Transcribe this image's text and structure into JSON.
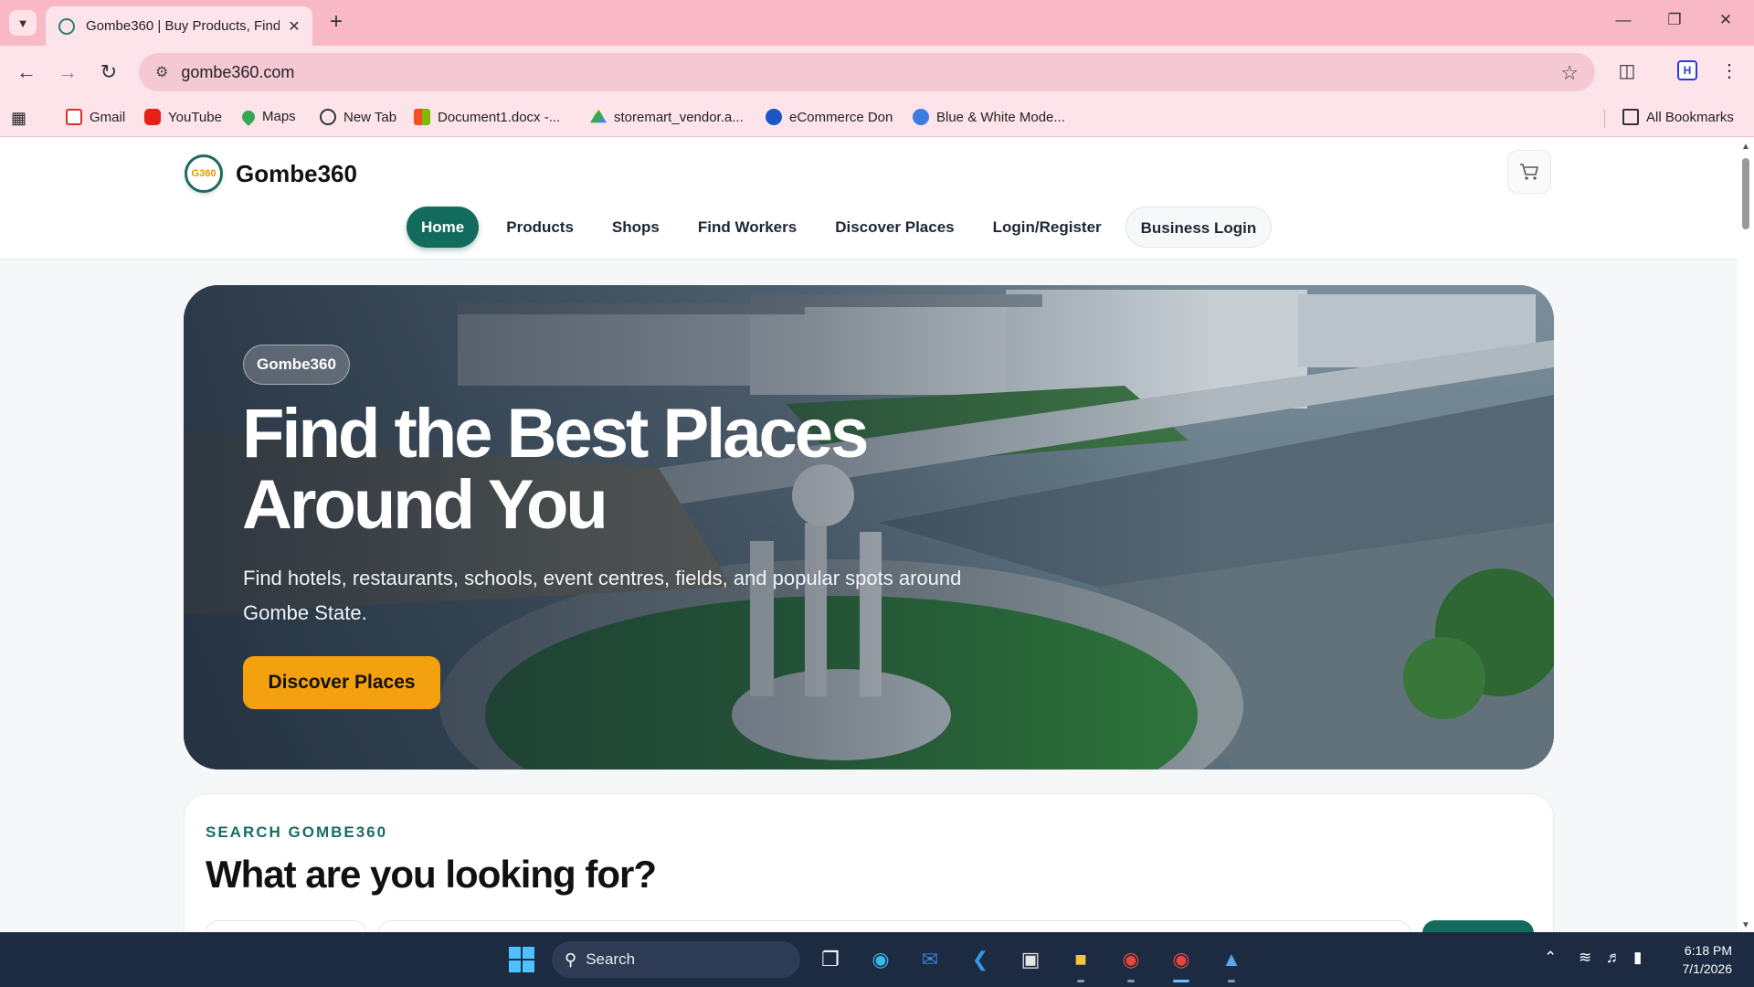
{
  "browser": {
    "tab_title": "Gombe360 | Buy Products, Find",
    "url": "gombe360.com",
    "bookmarks": [
      "Gmail",
      "YouTube",
      "Maps",
      "New Tab",
      "Document1.docx -...",
      "storemart_vendor.a...",
      "eCommerce Don",
      "Blue & White Mode..."
    ],
    "all_bookmarks": "All Bookmarks"
  },
  "site": {
    "logo_mark": "G360",
    "logo_text": "Gombe360",
    "nav": [
      "Home",
      "Products",
      "Shops",
      "Find Workers",
      "Discover Places",
      "Login/Register",
      "Business Login"
    ]
  },
  "hero": {
    "badge": "Gombe360",
    "title": "Find the Best Places Around You",
    "subtitle": "Find hotels, restaurants, schools, event centres, fields, and popular spots around Gombe State.",
    "cta": "Discover Places"
  },
  "search": {
    "eyebrow": "SEARCH GOMBE360",
    "heading": "What are you looking for?"
  },
  "taskbar": {
    "search_label": "Search",
    "time": "6:18 PM",
    "date": "7/1/2026"
  },
  "colors": {
    "brand_green": "#136b5d",
    "cta_orange": "#f3a10f",
    "chrome_pink": "#f9b8c6"
  }
}
